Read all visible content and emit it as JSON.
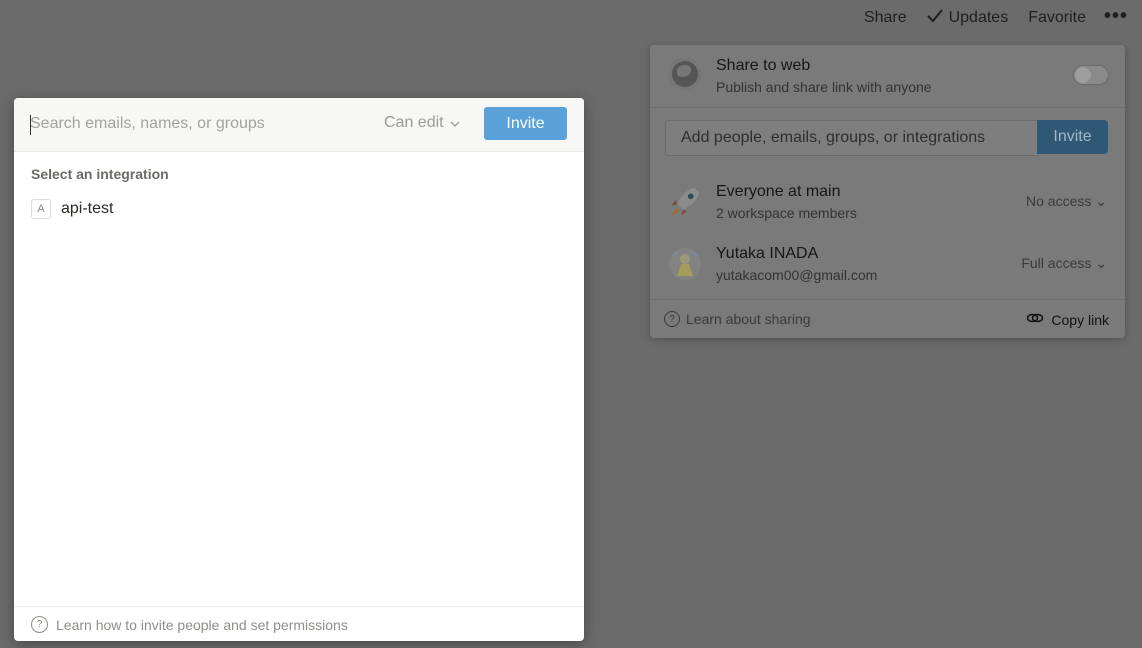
{
  "topbar": {
    "share": "Share",
    "updates": "Updates",
    "favorite": "Favorite",
    "more": "•••"
  },
  "share_popover": {
    "web_title": "Share to web",
    "web_subtitle": "Publish and share link with anyone",
    "add_placeholder": "Add people, emails, groups, or integrations",
    "invite_label": "Invite",
    "members": [
      {
        "name": "Everyone at main",
        "sub": "2 workspace members",
        "permission": "No access",
        "avatar": "rocket-icon"
      },
      {
        "name": "Yutaka INADA",
        "sub": "yutakacom00@gmail.com",
        "permission": "Full access",
        "avatar": "user-avatar"
      }
    ],
    "learn_label": "Learn about sharing",
    "copy_link_label": "Copy link"
  },
  "invite_modal": {
    "search_placeholder": "Search emails, names, or groups",
    "permission_label": "Can edit",
    "invite_label": "Invite",
    "section_label": "Select an integration",
    "integration": {
      "letter": "A",
      "name": "api-test"
    },
    "footer_label": "Learn how to invite people and set permissions"
  },
  "colors": {
    "accent": "#59a1d8",
    "overlay": "#6b6b6b"
  }
}
